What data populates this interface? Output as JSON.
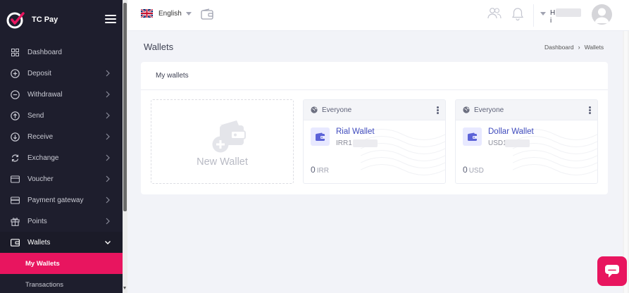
{
  "brand": {
    "name": "TC Pay"
  },
  "sidebar": {
    "items": [
      {
        "label": "Dashboard",
        "icon": "grid-icon",
        "has_arrow": false
      },
      {
        "label": "Deposit",
        "icon": "plus-circle-icon",
        "has_arrow": true
      },
      {
        "label": "Withdrawal",
        "icon": "minus-circle-icon",
        "has_arrow": true
      },
      {
        "label": "Send",
        "icon": "arrow-up-circle-icon",
        "has_arrow": true
      },
      {
        "label": "Receive",
        "icon": "arrow-down-circle-icon",
        "has_arrow": true
      },
      {
        "label": "Exchange",
        "icon": "exchange-icon",
        "has_arrow": true
      },
      {
        "label": "Voucher",
        "icon": "voucher-icon",
        "has_arrow": true
      },
      {
        "label": "Payment gateway",
        "icon": "card-icon",
        "has_arrow": true
      },
      {
        "label": "Points",
        "icon": "gift-icon",
        "has_arrow": true
      },
      {
        "label": "Wallets",
        "icon": "wallet-icon",
        "has_arrow": true,
        "expanded": true
      }
    ],
    "submenu": [
      {
        "label": "My Wallets",
        "active": true
      },
      {
        "label": "Transactions",
        "active": false
      }
    ]
  },
  "header": {
    "language": "English",
    "user_name_initial": "H",
    "user_name_final": "i"
  },
  "page": {
    "title": "Wallets",
    "breadcrumb": [
      "Dashboard",
      "Wallets"
    ]
  },
  "card": {
    "title": "My wallets",
    "new_wallet_label": "New Wallet",
    "wallets": [
      {
        "visibility": "Everyone",
        "name": "Rial Wallet",
        "code_prefix": "IRR1",
        "balance": "0",
        "currency": "IRR"
      },
      {
        "visibility": "Everyone",
        "name": "Dollar Wallet",
        "code_prefix": "USD1",
        "balance": "0",
        "currency": "USD"
      }
    ]
  },
  "colors": {
    "sidebar_bg": "#1e1e2d",
    "accent": "#e8155f",
    "wallet_name": "#3f4bbd",
    "page_bg": "#f2f3f8"
  }
}
